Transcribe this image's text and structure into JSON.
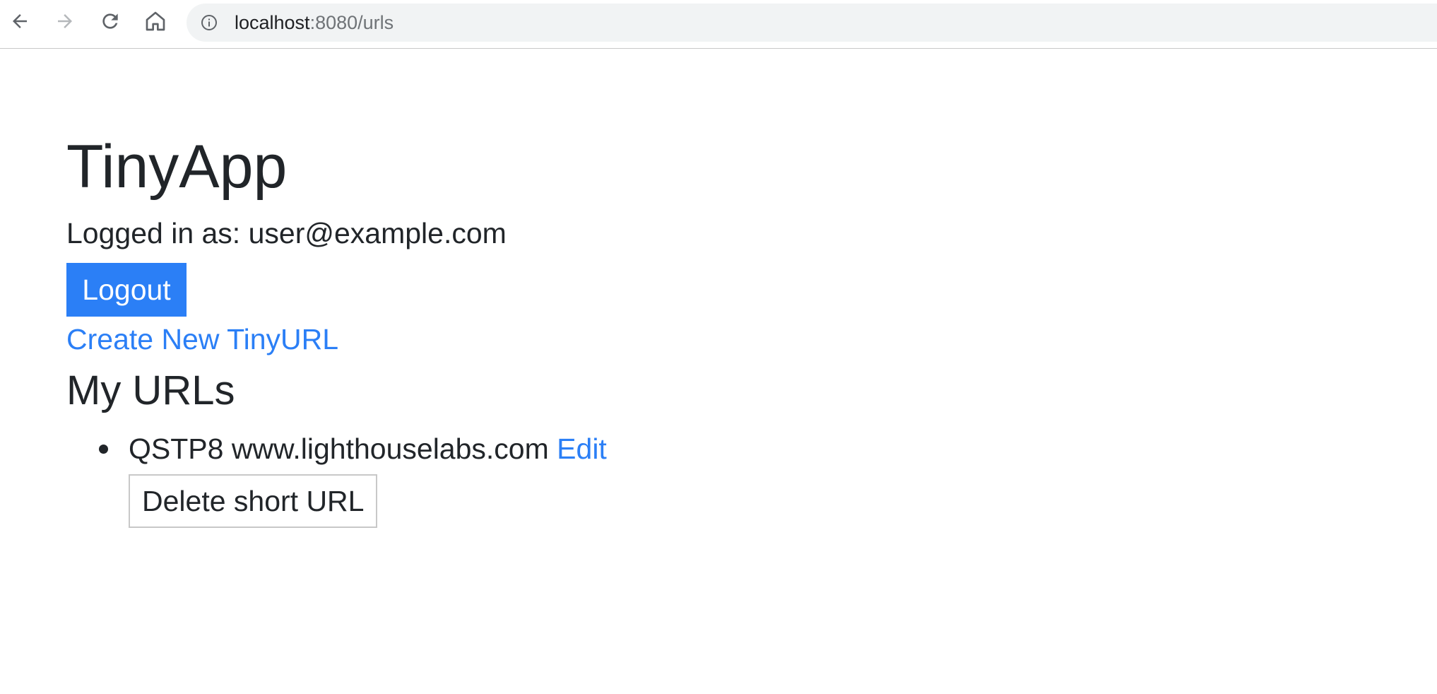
{
  "browser": {
    "url_host": "localhost",
    "url_path": ":8080/urls",
    "icons": {
      "back": "arrow-left-icon",
      "forward": "arrow-right-icon",
      "reload": "reload-icon",
      "home": "home-icon",
      "site_info": "info-icon"
    }
  },
  "page": {
    "title": "TinyApp",
    "logged_in_label": "Logged in as: user@example.com",
    "logout_label": "Logout",
    "create_link_label": "Create New TinyURL",
    "section_title": "My URLs",
    "urls": [
      {
        "text": "QSTP8 www.lighthouselabs.com",
        "edit_label": "Edit",
        "delete_label": "Delete short URL"
      }
    ]
  },
  "colors": {
    "accent": "#2b7ff6",
    "text": "#212529",
    "omnibox_bg": "#f1f3f4"
  }
}
